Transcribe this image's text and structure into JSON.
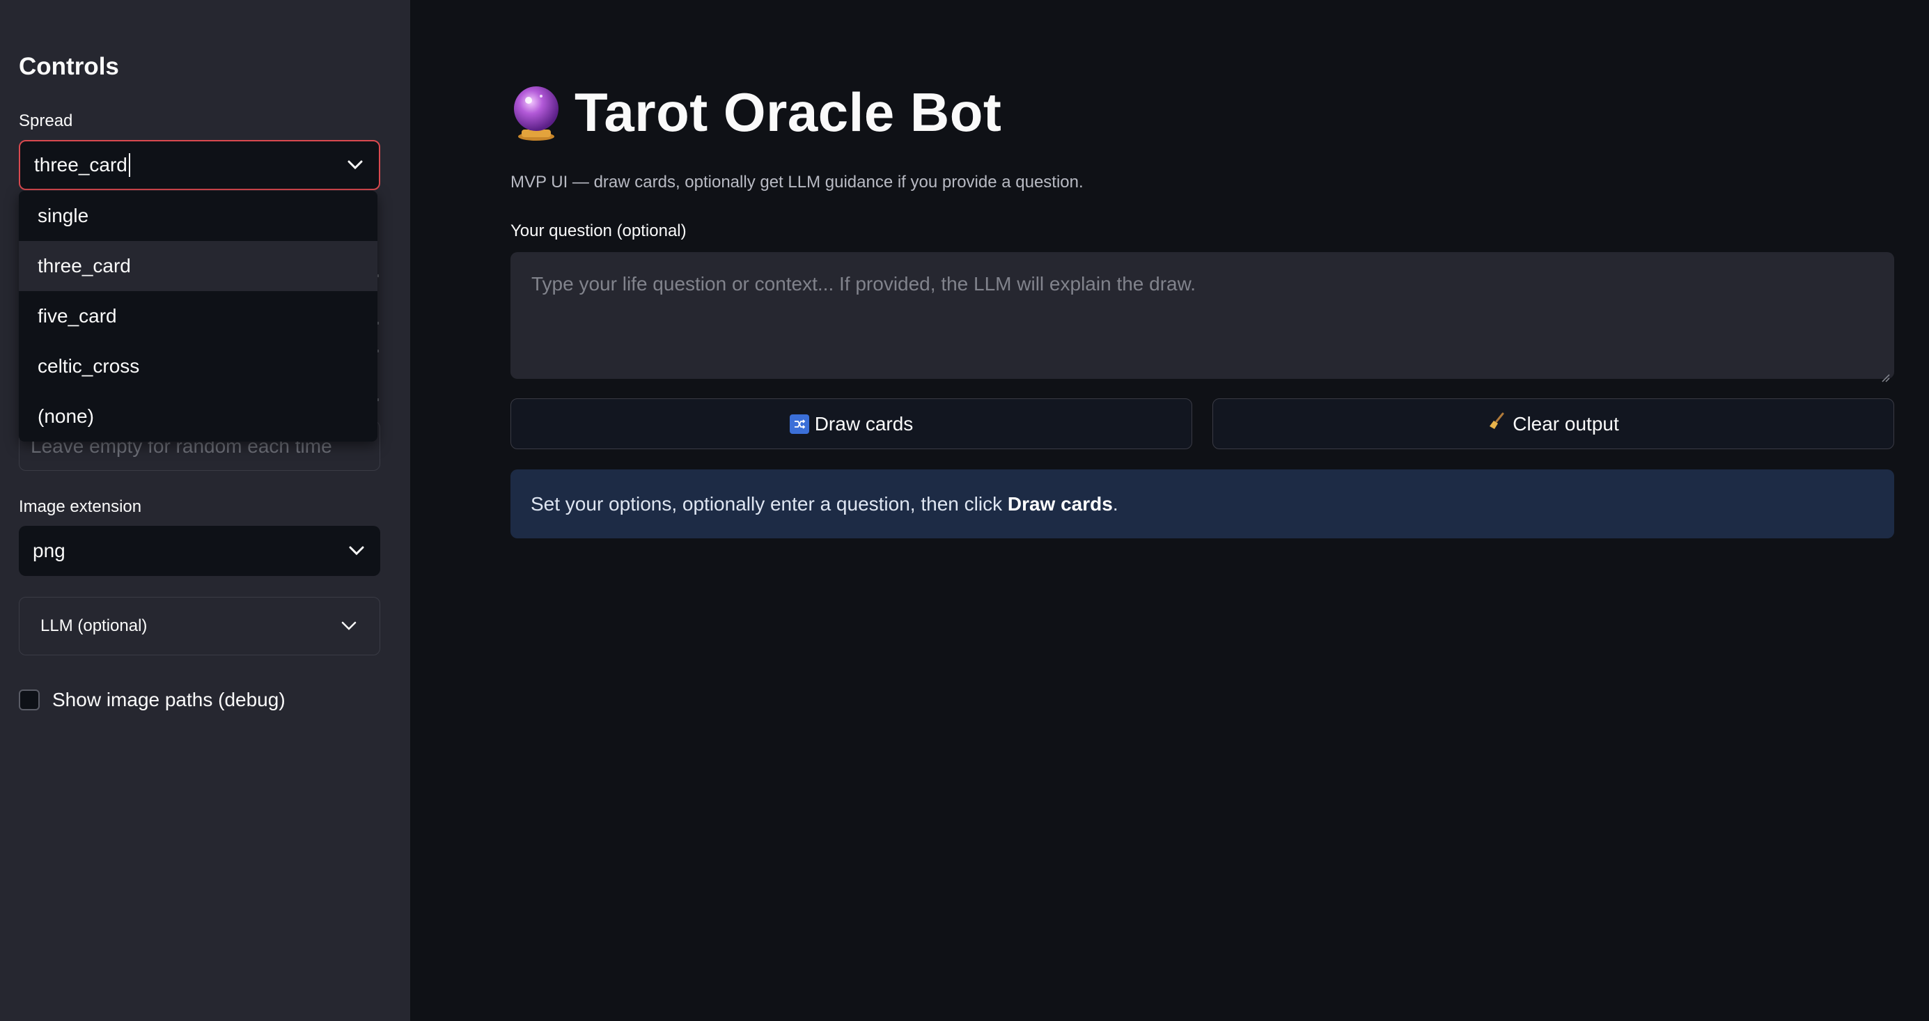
{
  "sidebar": {
    "title": "Controls",
    "spread": {
      "label": "Spread",
      "value": "three_card",
      "options": [
        "single",
        "three_card",
        "five_card",
        "celtic_cross",
        "(none)"
      ],
      "selected": "three_card"
    },
    "seed": {
      "placeholder": "Leave empty for random each time"
    },
    "image_extension": {
      "label": "Image extension",
      "value": "png"
    },
    "llm_expander": {
      "label": "LLM (optional)"
    },
    "debug_checkbox": {
      "label": "Show image paths (debug)",
      "checked": false
    }
  },
  "main": {
    "title": "Tarot Oracle Bot",
    "title_icon": "crystal-ball-icon",
    "subtitle": "MVP UI — draw cards, optionally get LLM guidance if you provide a question.",
    "question": {
      "label": "Your question (optional)",
      "placeholder": "Type your life question or context... If provided, the LLM will explain the draw."
    },
    "buttons": {
      "draw": "Draw cards",
      "clear": "Clear output"
    },
    "info": {
      "prefix": "Set your options, optionally enter a question, then click ",
      "bold": "Draw cards",
      "suffix": "."
    }
  },
  "colors": {
    "background": "#0f1116",
    "sidebar": "#262730",
    "focus_border": "#d9494f",
    "info_bg": "#1d2b45"
  }
}
